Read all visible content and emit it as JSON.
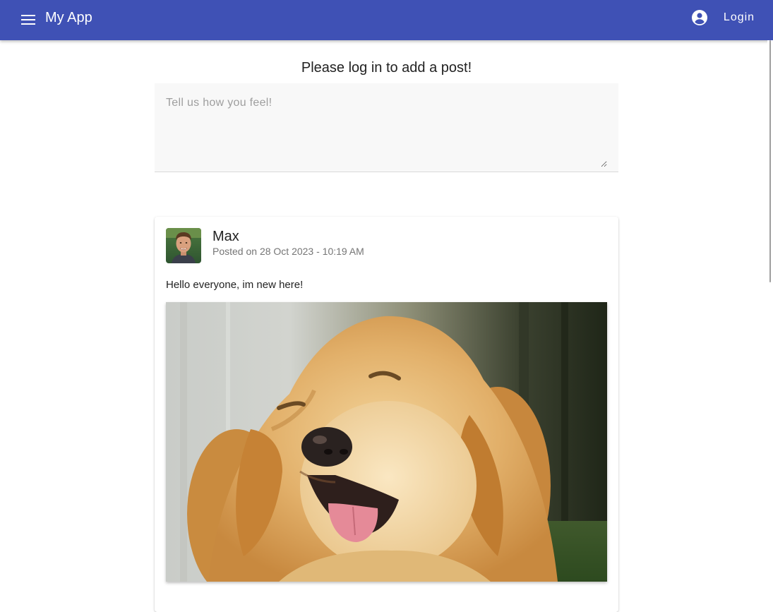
{
  "header": {
    "title": "My App",
    "menu_icon": "menu-icon",
    "account_icon": "account-circle-icon",
    "login_label": "Login",
    "color": "#3f51b5"
  },
  "main": {
    "prompt": "Please log in to add a post!",
    "post_input": {
      "placeholder": "Tell us how you feel!",
      "value": ""
    }
  },
  "posts": [
    {
      "author": "Max",
      "posted": "Posted on 28 Oct 2023 - 10:19 AM",
      "text": "Hello everyone, im new here!",
      "image": "dog-photo"
    }
  ]
}
